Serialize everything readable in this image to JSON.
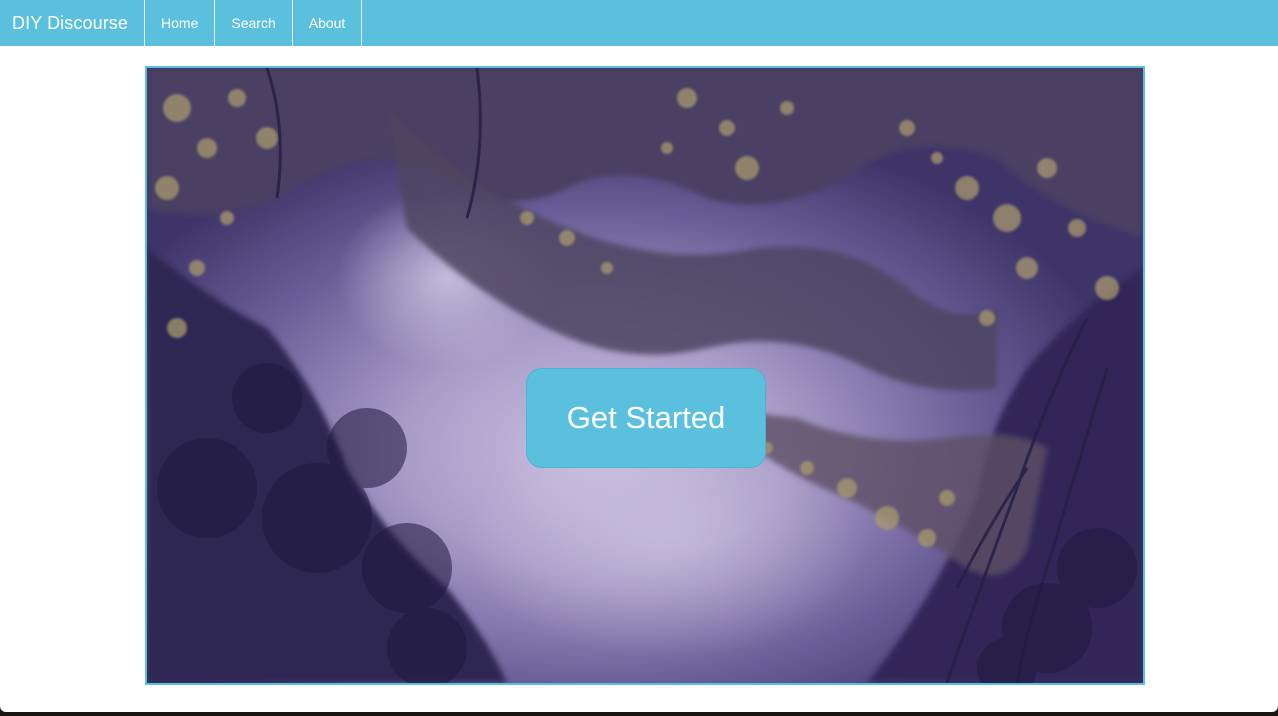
{
  "navbar": {
    "brand": "DIY Discourse",
    "links": [
      "Home",
      "Search",
      "About"
    ],
    "color": "#5bc0de"
  },
  "hero": {
    "image": "photo-reflection-of-trees-in-water",
    "cta_label": "Get Started",
    "cta_color": "#5bc0de"
  }
}
